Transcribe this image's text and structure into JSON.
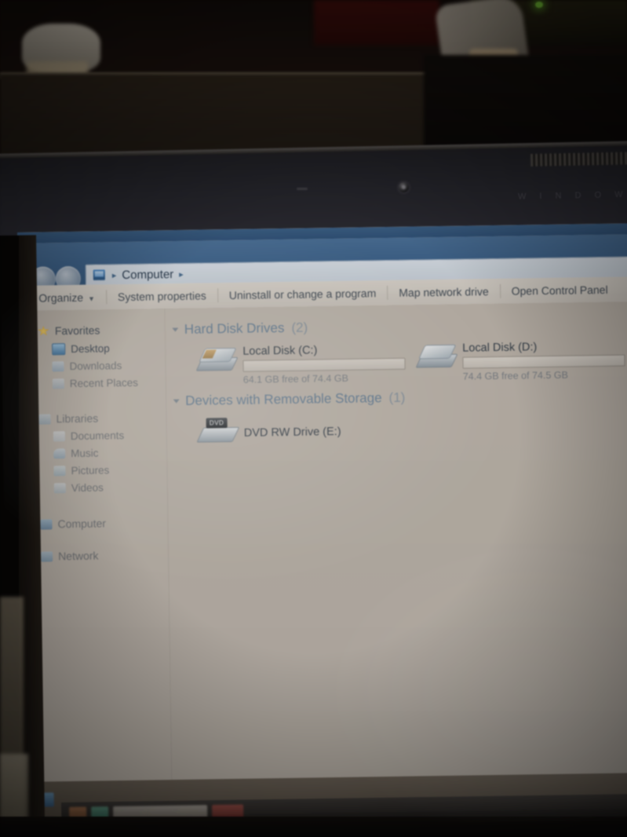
{
  "scene": {
    "description": "photo-of-laptop-screen",
    "bezel_brand": "W I N D O W S"
  },
  "window": {
    "address_bar": {
      "icon": "computer-icon",
      "crumbs": [
        "Computer"
      ],
      "separator": "▸",
      "leading_separator": "▸"
    },
    "nav": {
      "back_glyph": "◀",
      "forward_glyph": "▶"
    },
    "toolbar": {
      "organize_label": "Organize",
      "organize_caret": "▼",
      "items": [
        "System properties",
        "Uninstall or change a program",
        "Map network drive",
        "Open Control Panel"
      ]
    }
  },
  "sidebar": {
    "groups": [
      {
        "label": "Favorites",
        "icon": "star-icon",
        "items": [
          {
            "label": "Desktop",
            "icon": "desktop-icon"
          },
          {
            "label": "Downloads",
            "icon": "downloads-icon"
          },
          {
            "label": "Recent Places",
            "icon": "recent-places-icon"
          }
        ]
      },
      {
        "label": "Libraries",
        "icon": "libraries-icon",
        "items": [
          {
            "label": "Documents",
            "icon": "documents-icon"
          },
          {
            "label": "Music",
            "icon": "music-icon"
          },
          {
            "label": "Pictures",
            "icon": "pictures-icon"
          },
          {
            "label": "Videos",
            "icon": "videos-icon"
          }
        ]
      },
      {
        "label": "Computer",
        "icon": "computer-icon",
        "items": []
      },
      {
        "label": "Network",
        "icon": "network-icon",
        "items": []
      }
    ]
  },
  "content": {
    "groups": [
      {
        "title": "Hard Disk Drives",
        "count": "(2)",
        "collapse_glyph": "▴",
        "drives": [
          {
            "name": "Local Disk (C:)",
            "icon": "hard-disk-icon",
            "free_text": "64.1 GB free of 74.4 GB",
            "used_percent": 14,
            "bar_color": "#2a93b8"
          },
          {
            "name": "Local Disk (D:)",
            "icon": "hard-disk-icon",
            "free_text": "74.4 GB free of 74.5 GB",
            "used_percent": 1,
            "bar_color": "#2a93b8"
          }
        ]
      },
      {
        "title": "Devices with Removable Storage",
        "count": "(1)",
        "collapse_glyph": "▴",
        "drives": [
          {
            "name": "DVD RW Drive (E:)",
            "icon": "dvd-drive-icon",
            "badge": "DVD",
            "free_text": "",
            "used_percent": 0
          }
        ]
      }
    ]
  },
  "status_bar": {
    "icon": "computer-icon",
    "text": ""
  }
}
